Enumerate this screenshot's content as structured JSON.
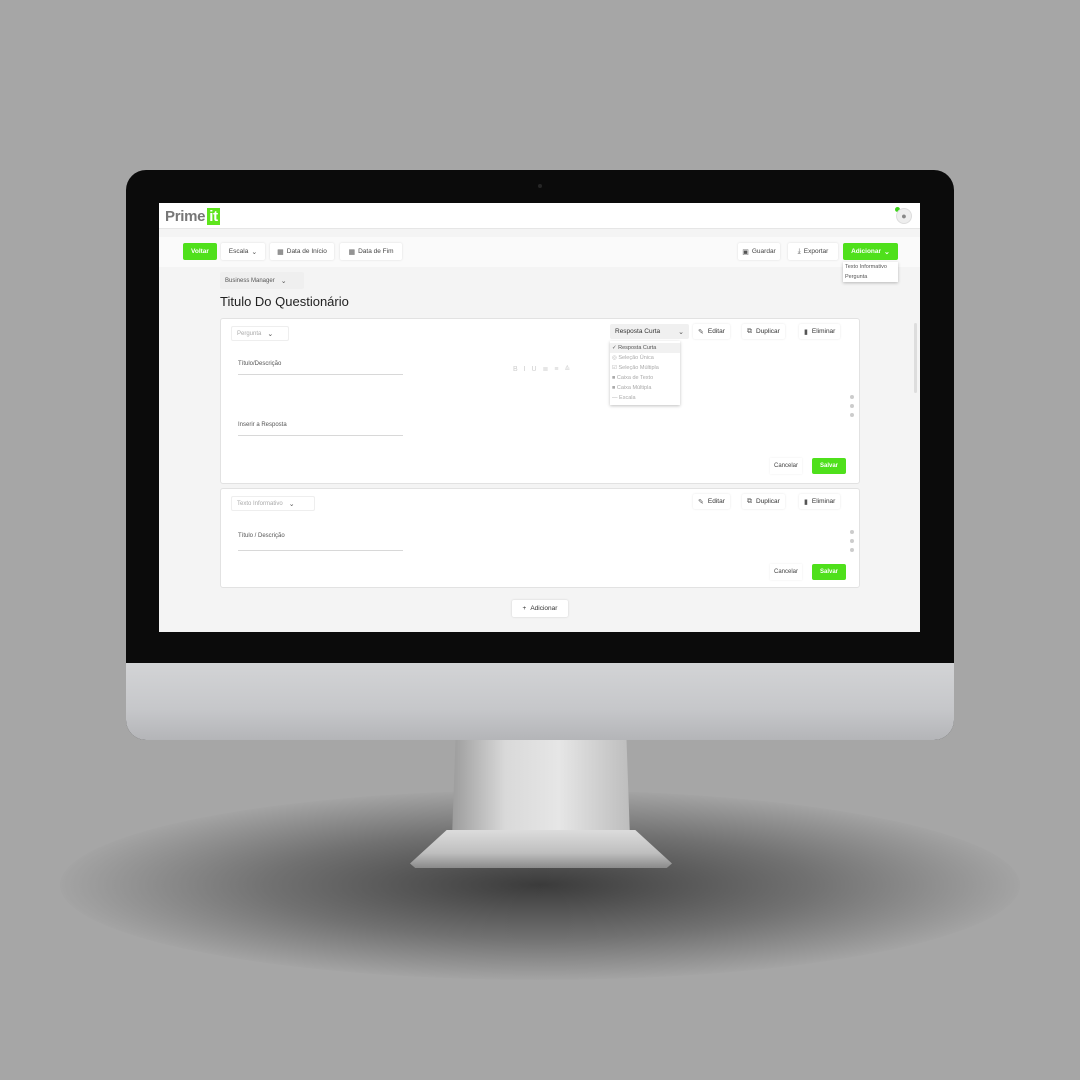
{
  "app": {
    "logo_text": "Prime",
    "logo_badge": "it"
  },
  "colors": {
    "accent": "#4fe01b",
    "background": "#a6a6a6"
  },
  "toolbar": {
    "back_label": "Voltar",
    "scale_label": "Escala",
    "start_date_label": "Data de Início",
    "end_date_label": "Data de Fim",
    "save_label": "Guardar",
    "export_label": "Exportar",
    "add_label": "Adicionar",
    "add_menu": [
      "Texto Informativo",
      "Pergunta"
    ]
  },
  "header": {
    "role_selected": "Business Manager",
    "title": "Titulo Do Questionário"
  },
  "question_card": {
    "type_selected": "Pergunta",
    "answer_type_selected": "Resposta  Curta",
    "answer_type_options": [
      "Resposta  Curta",
      "Seleção Única",
      "Seleção Múltipla",
      "Caixa de Texto",
      "Caixa Múltipla",
      "Escala"
    ],
    "title_label": "Título/Descrição",
    "answer_label": "Inserir a Resposta",
    "format_toolbar": "B I U ≣ ≡ ≙",
    "edit_label": "Editar",
    "duplicate_label": "Duplicar",
    "delete_label": "Eliminar",
    "cancel_label": "Cancelar",
    "save_label": "Salvar"
  },
  "info_card": {
    "type_selected": "Texto Informativo",
    "title_label": "Título / Descrição",
    "edit_label": "Editar",
    "duplicate_label": "Duplicar",
    "delete_label": "Eliminar",
    "cancel_label": "Cancelar",
    "save_label": "Salvar"
  },
  "footer": {
    "add_label": "Adicionar"
  }
}
